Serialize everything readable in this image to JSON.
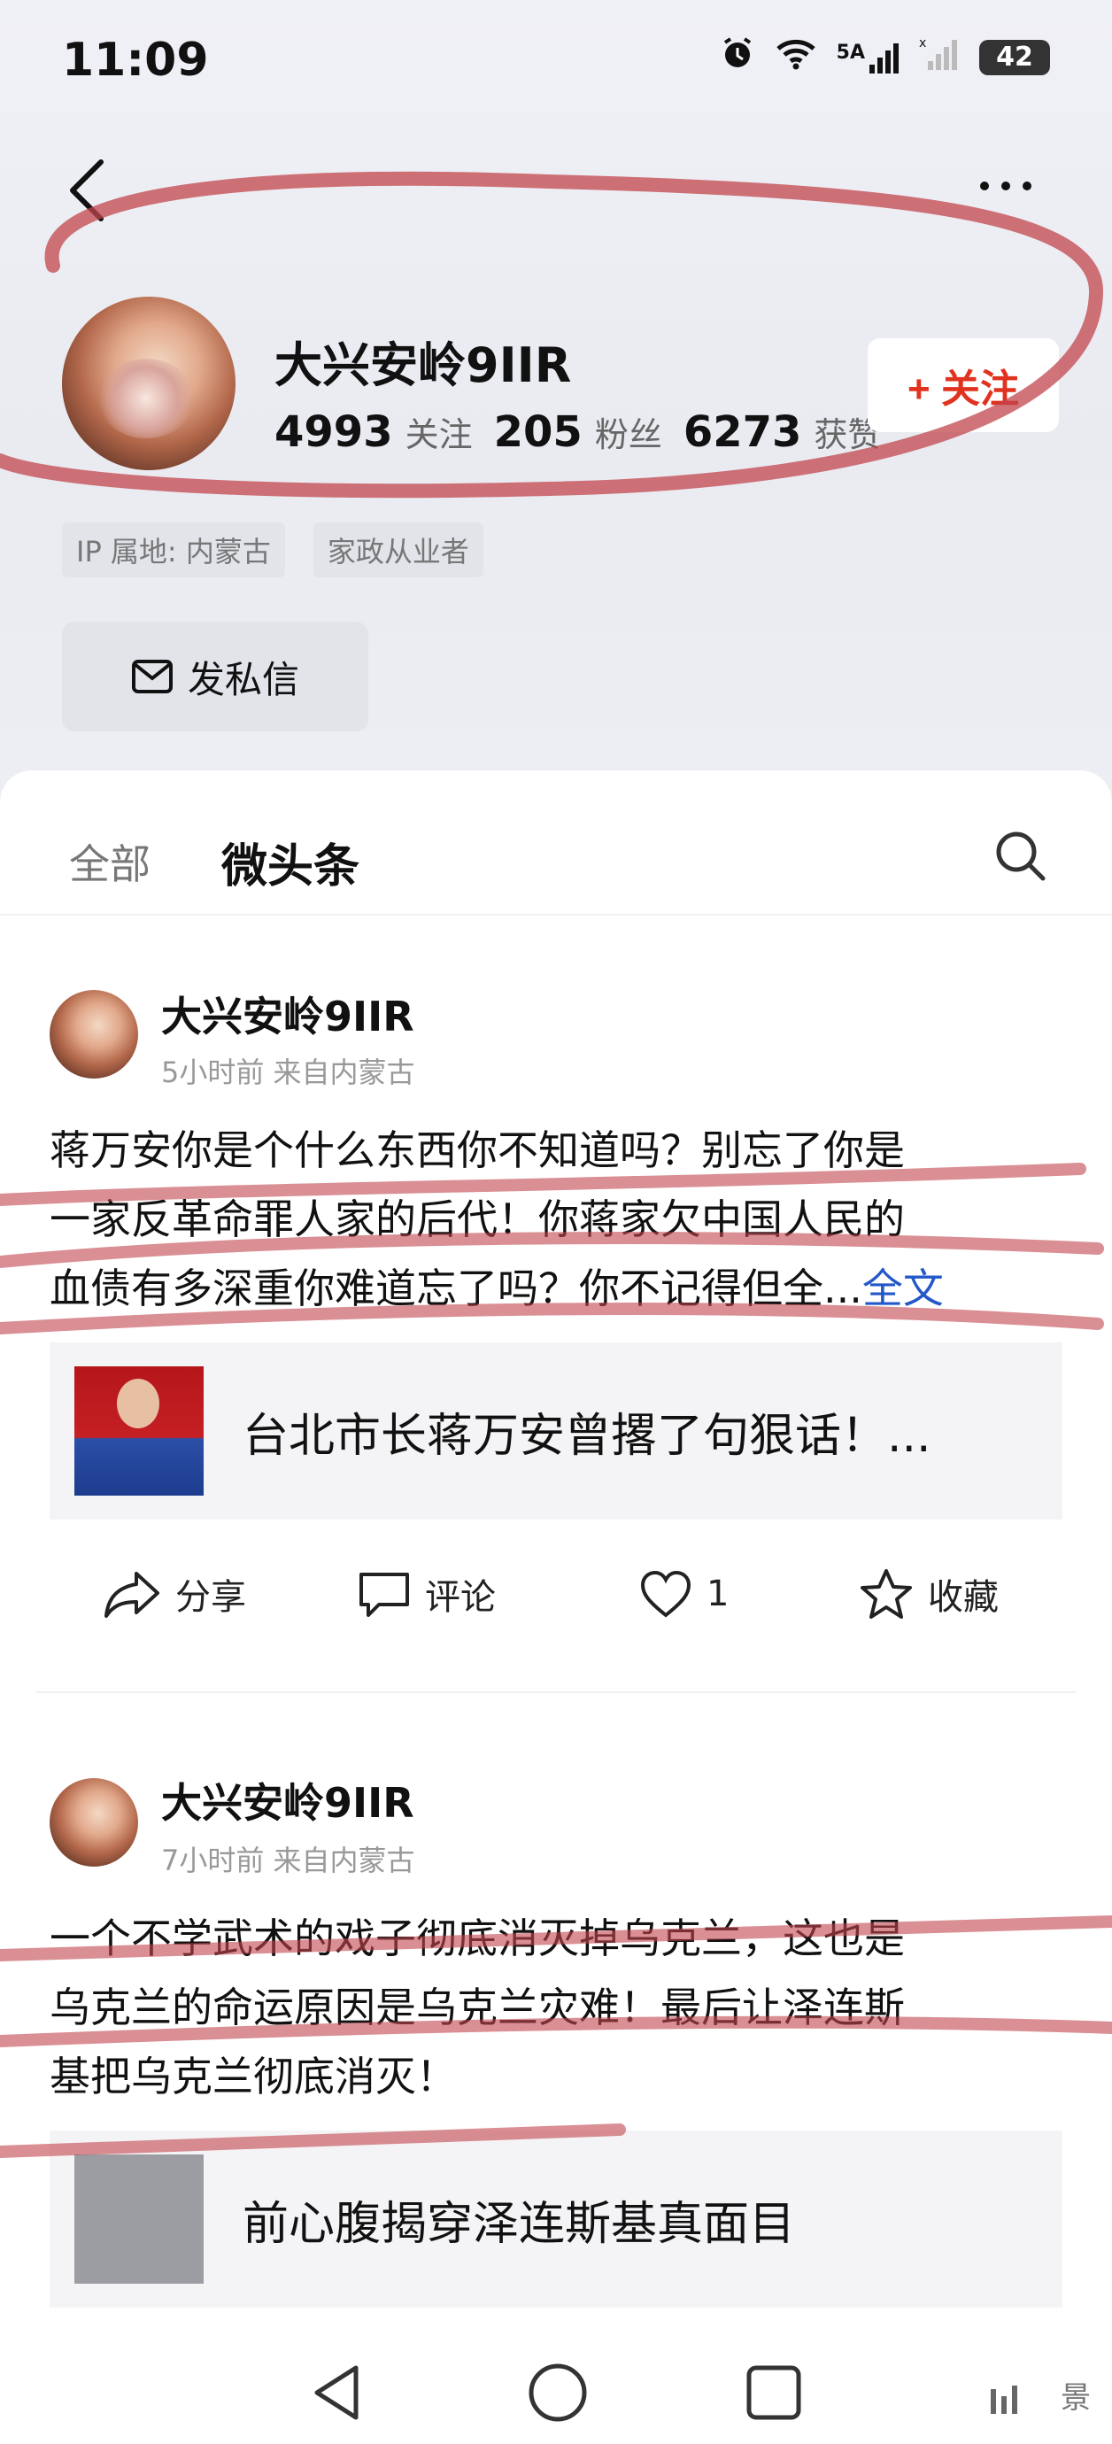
{
  "status_bar": {
    "time": "11:09",
    "network": "5A",
    "battery": "42",
    "icons": [
      "alarm-icon",
      "wifi-icon",
      "signal-icon",
      "signal-x-icon",
      "battery-icon"
    ]
  },
  "profile": {
    "name": "大兴安岭9IIR",
    "follow_button": "+ 关注",
    "stats": [
      {
        "value": "4993",
        "label": "关注"
      },
      {
        "value": "205",
        "label": "粉丝"
      },
      {
        "value": "6273",
        "label": "获赞"
      }
    ],
    "tags": [
      "IP 属地: 内蒙古",
      "家政从业者"
    ],
    "message_button": "发私信"
  },
  "tabs": {
    "all": "全部",
    "active": "微头条"
  },
  "posts": [
    {
      "author": "大兴安岭9IIR",
      "meta": "5小时前 来自内蒙古",
      "lines": [
        "蒋万安你是个什么东西你不知道吗？别忘了你是",
        "一家反革命罪人家的后代！你蒋家欠中国人民的",
        "血债有多深重你难道忘了吗？你不记得但全..."
      ],
      "full_text_link": "全文",
      "link_card_title": "台北市长蒋万安曾撂了句狠话！..."
    },
    {
      "author": "大兴安岭9IIR",
      "meta": "7小时前 来自内蒙古",
      "lines": [
        "一个不学武术的戏子彻底消灭掉乌克兰，这也是",
        "乌克兰的命运原因是乌克兰灾难！最后让泽连斯",
        "基把乌克兰彻底消灭！"
      ],
      "link_card_title": "前心腹揭穿泽连斯基真面目"
    }
  ],
  "actions": {
    "share": "分享",
    "comment": "评论",
    "like_count": "1",
    "favorite": "收藏"
  },
  "watermark": "景",
  "colors": {
    "follow_red": "#e0321f",
    "link_blue": "#2458c9",
    "scribble_red": "#c2454c"
  }
}
